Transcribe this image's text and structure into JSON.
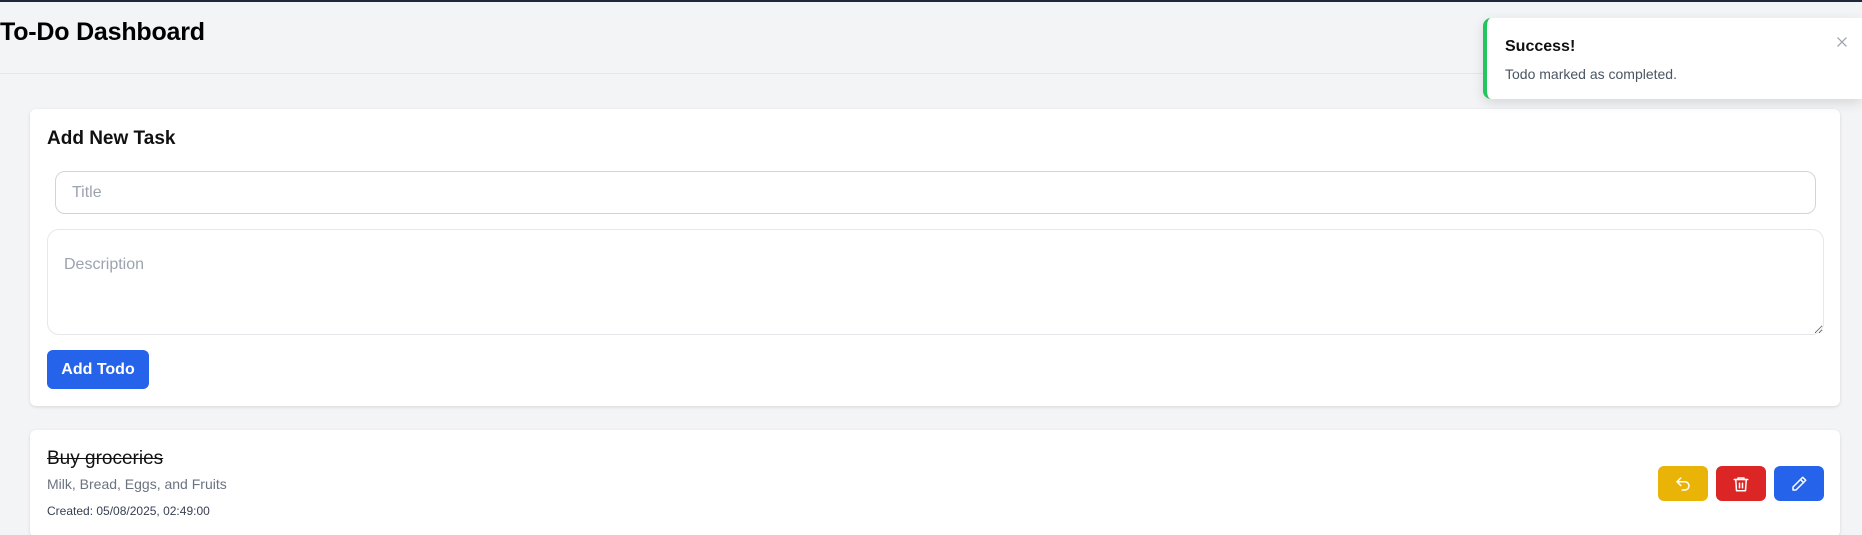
{
  "header": {
    "title": "To-Do Dashboard"
  },
  "add_task": {
    "title": "Add New Task",
    "title_placeholder": "Title",
    "description_placeholder": "Description",
    "add_button_label": "Add Todo"
  },
  "todos": [
    {
      "title": "Buy groceries",
      "description": "Milk, Bread, Eggs, and Fruits",
      "created": "Created: 05/08/2025, 02:49:00",
      "completed": true,
      "actions": [
        {
          "name": "undo",
          "icon": "undo-icon",
          "color": "#eab308"
        },
        {
          "name": "delete",
          "icon": "trash-icon",
          "color": "#dc2626"
        },
        {
          "name": "edit",
          "icon": "pencil-icon",
          "color": "#2563eb"
        }
      ]
    }
  ],
  "toast": {
    "title": "Success!",
    "message": "Todo marked as completed.",
    "accent_color": "#22c55e"
  },
  "colors": {
    "primary": "#2563eb",
    "background": "#f3f4f6"
  }
}
